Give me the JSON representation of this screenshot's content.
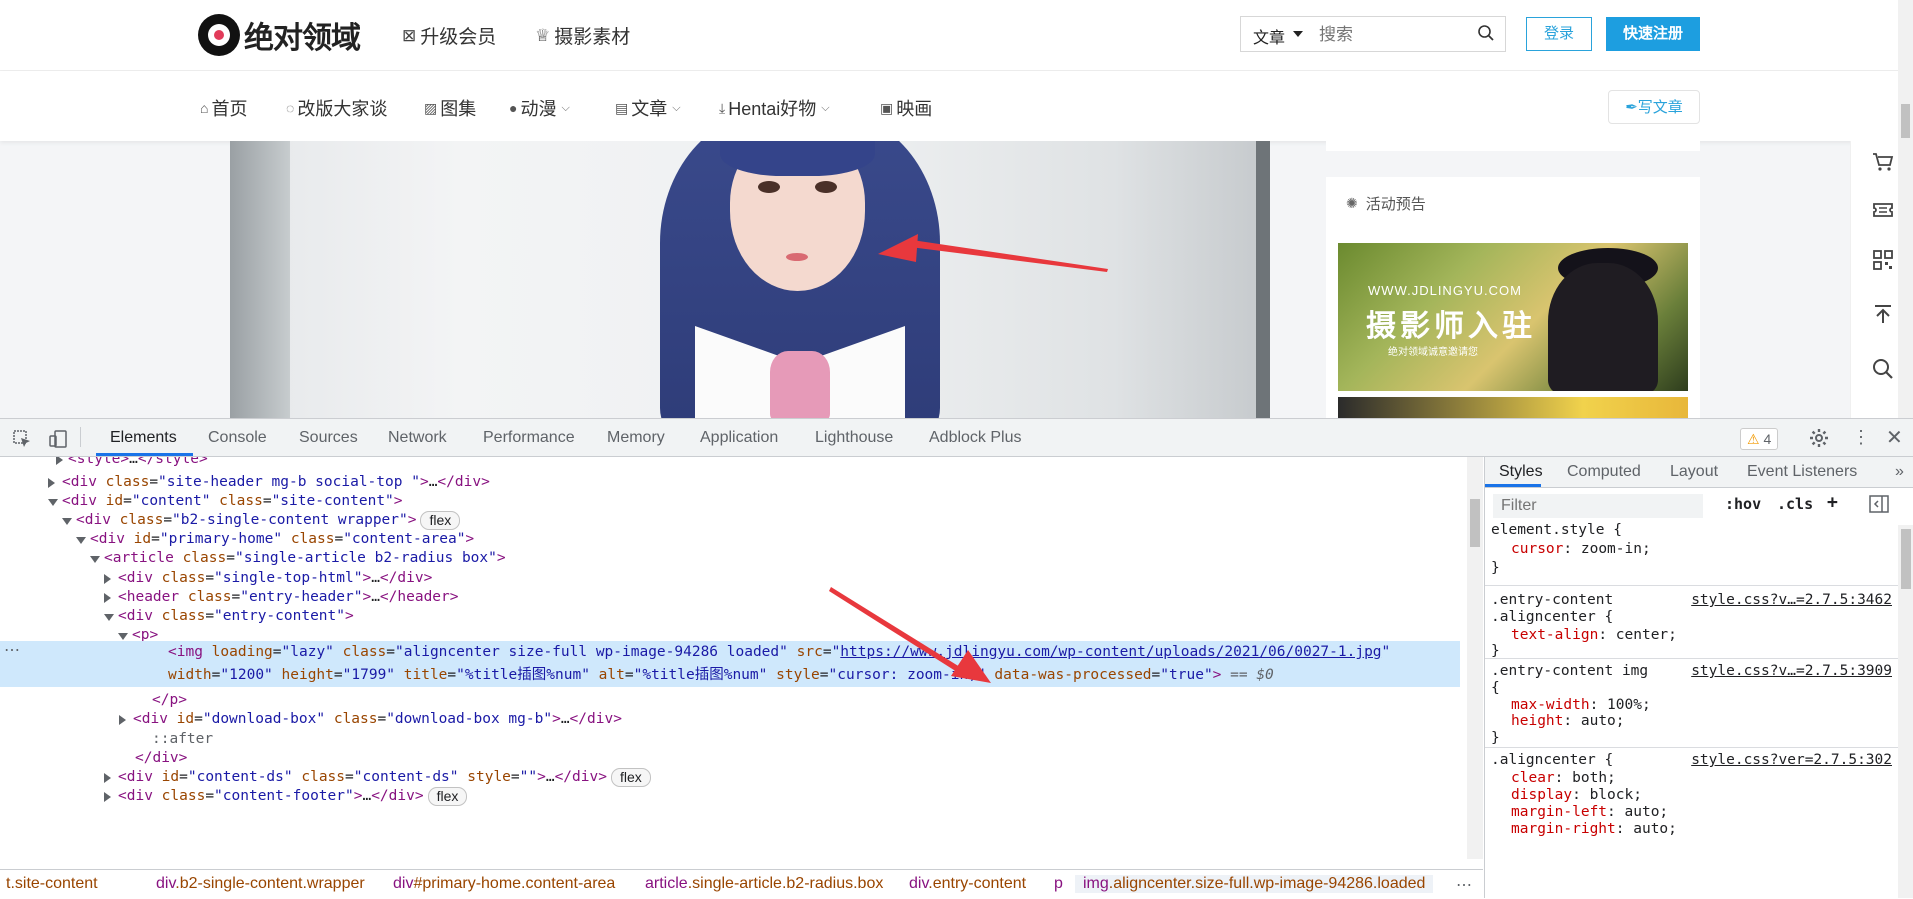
{
  "site": {
    "logo_text": "绝对领域",
    "top_links": [
      "升级会员",
      "摄影素材"
    ],
    "search": {
      "category": "文章",
      "placeholder": "搜索"
    },
    "login_label": "登录",
    "register_label": "快速注册",
    "nav": [
      {
        "label": "首页",
        "icon": "home-icon",
        "has_dropdown": false
      },
      {
        "label": "改版大家谈",
        "icon": "chat-icon",
        "has_dropdown": false
      },
      {
        "label": "图集",
        "icon": "image-icon",
        "has_dropdown": false
      },
      {
        "label": "动漫",
        "icon": "anime-icon",
        "has_dropdown": true
      },
      {
        "label": "文章",
        "icon": "document-icon",
        "has_dropdown": true
      },
      {
        "label": "Hentai好物",
        "icon": "download-icon",
        "has_dropdown": true
      },
      {
        "label": "映画",
        "icon": "film-icon",
        "has_dropdown": false
      }
    ],
    "write_label": "写文章",
    "sidebar": {
      "event_title": "活动预告",
      "promo": {
        "url": "WWW.JDLINGYU.COM",
        "headline": "摄影师入驻",
        "sub": "绝对领域诚意邀请您"
      }
    },
    "rail_icons": [
      "cart-icon",
      "ticket-icon",
      "qrcode-icon",
      "back-to-top-icon",
      "search-icon"
    ]
  },
  "devtools": {
    "tabs": [
      "Elements",
      "Console",
      "Sources",
      "Network",
      "Performance",
      "Memory",
      "Application",
      "Lighthouse",
      "Adblock Plus"
    ],
    "active_tab": "Elements",
    "warning_count": "4",
    "dom_lines": [
      {
        "text_parts": [
          "<style>",
          "…",
          "</style>"
        ]
      },
      {
        "tag": "div",
        "attrs": [
          [
            "class",
            "site-header mg-b social-top "
          ]
        ],
        "collapsed": true
      },
      {
        "tag": "div",
        "attrs": [
          [
            "id",
            "content"
          ],
          [
            "class",
            "site-content"
          ]
        ]
      },
      {
        "tag": "div",
        "attrs": [
          [
            "class",
            "b2-single-content wrapper"
          ]
        ],
        "badge": "flex"
      },
      {
        "tag": "div",
        "attrs": [
          [
            "id",
            "primary-home"
          ],
          [
            "class",
            "content-area"
          ]
        ]
      },
      {
        "tag": "article",
        "attrs": [
          [
            "class",
            "single-article b2-radius box"
          ]
        ]
      },
      {
        "tag": "div",
        "attrs": [
          [
            "class",
            "single-top-html"
          ]
        ],
        "collapsed": true
      },
      {
        "tag": "header",
        "attrs": [
          [
            "class",
            "entry-header"
          ]
        ],
        "collapsed": true
      },
      {
        "tag": "div",
        "attrs": [
          [
            "class",
            "entry-content"
          ]
        ]
      },
      {
        "tag": "p"
      },
      {
        "selected": true,
        "img_line1": [
          "img",
          "loading",
          "lazy",
          "class",
          "aligncenter size-full wp-image-94286 loaded",
          "src",
          "https://www.jdlingyu.com/wp-content/uploads/2021/06/0027-1.jpg"
        ],
        "img_line2": [
          "width",
          "1200",
          "height",
          "1799",
          "title",
          "%title插图%num",
          "alt",
          "%title插图%num",
          "style",
          "cursor: zoom-in;",
          "data-was-processed",
          "true",
          "== $0"
        ]
      },
      {
        "close": "</p>"
      },
      {
        "tag": "div",
        "attrs": [
          [
            "id",
            "download-box"
          ],
          [
            "class",
            "download-box mg-b"
          ]
        ],
        "collapsed": true
      },
      {
        "pseudo": "::after"
      },
      {
        "close": "</div>"
      },
      {
        "tag": "div",
        "attrs": [
          [
            "id",
            "content-ds"
          ],
          [
            "class",
            "content-ds"
          ],
          [
            "style",
            ""
          ]
        ],
        "collapsed": true,
        "badge": "flex"
      },
      {
        "tag": "div",
        "attrs": [
          [
            "class",
            "content-footer"
          ]
        ],
        "collapsed": true,
        "badge": "flex"
      }
    ],
    "breadcrumbs": [
      {
        "tag": "",
        "cls": "t.site-content"
      },
      {
        "tag": "div",
        "cls": ".b2-single-content.wrapper"
      },
      {
        "tag": "div",
        "cls": "#primary-home.content-area"
      },
      {
        "tag": "article",
        "cls": ".single-article.b2-radius.box"
      },
      {
        "tag": "div",
        "cls": ".entry-content"
      },
      {
        "tag": "p",
        "cls": ""
      },
      {
        "tag": "img",
        "cls": ".aligncenter.size-full.wp-image-94286.loaded"
      }
    ],
    "styles_tabs": [
      "Styles",
      "Computed",
      "Layout",
      "Event Listeners"
    ],
    "filter_placeholder": "Filter",
    "filter_buttons": [
      ":hov",
      ".cls",
      "+"
    ],
    "rules": [
      {
        "selector": [
          "element.style {"
        ],
        "source": "",
        "props": [
          [
            "cursor",
            "zoom-in;"
          ]
        ]
      },
      {
        "selector": [
          ".entry-content",
          ".aligncenter {"
        ],
        "source": "style.css?v…=2.7.5:3462",
        "props": [
          [
            "text-align",
            "center;"
          ]
        ]
      },
      {
        "selector": [
          ".entry-content img",
          "{"
        ],
        "source": "style.css?v…=2.7.5:3909",
        "props": [
          [
            "max-width",
            "100%;"
          ],
          [
            "height",
            "auto;"
          ]
        ]
      },
      {
        "selector": [
          ".aligncenter {"
        ],
        "source": "style.css?ver=2.7.5:302",
        "props": [
          [
            "clear",
            "both;"
          ],
          [
            "display",
            "block;"
          ],
          [
            "margin-left",
            "auto;"
          ],
          [
            "margin-right",
            "auto;"
          ]
        ]
      }
    ]
  },
  "colors": {
    "accent_blue": "#1d9ee0",
    "devtools_blue": "#1a73e8",
    "arrow_red": "#e8383d",
    "selection": "#cfe8fc"
  }
}
